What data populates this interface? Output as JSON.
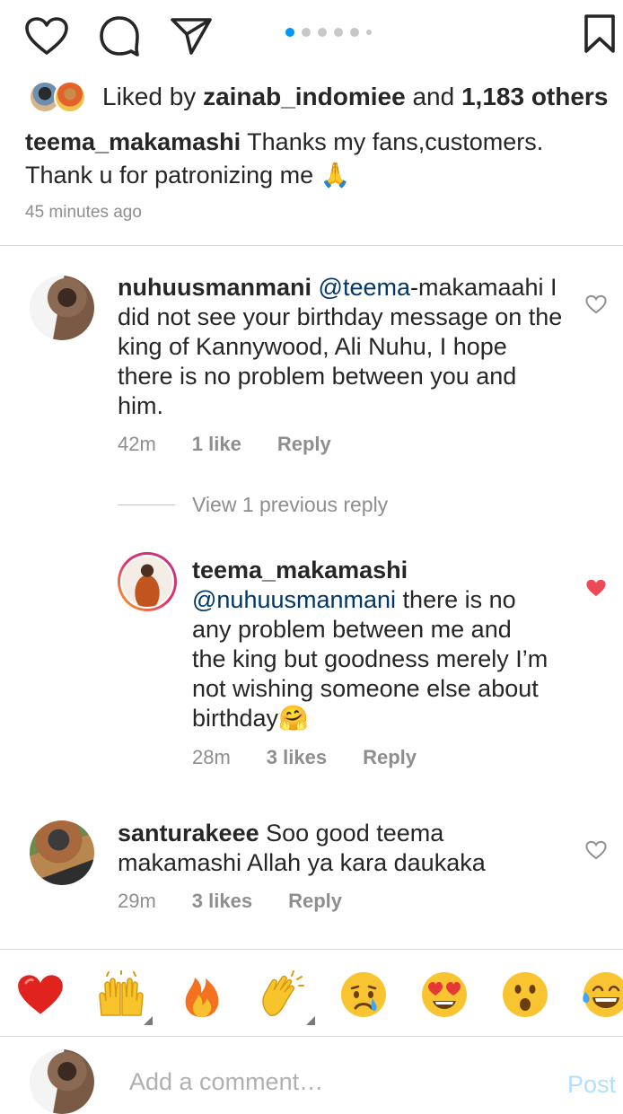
{
  "actions": {
    "like_icon": "heart-outline-icon",
    "comment_icon": "comment-bubble-icon",
    "share_icon": "send-paper-plane-icon",
    "save_icon": "bookmark-icon"
  },
  "carousel": {
    "total": 6,
    "active_index": 0
  },
  "likes": {
    "prefix": "Liked by ",
    "user": "zainab_indomiee",
    "middle": " and ",
    "others": "1,183 others"
  },
  "caption": {
    "username": "teema_makamashi",
    "text": " Thanks my fans,customers. Thank u for patronizing me 🙏"
  },
  "post_time": "45 minutes ago",
  "comments": [
    {
      "username": "nuhuusmanmani",
      "mention": "@teema",
      "text": "-makamaahi I did not see your birthday message on the king of Kannywood, Ali Nuhu, I hope there is no problem between you and him.",
      "time": "42m",
      "likes": "1 like",
      "reply_label": "Reply",
      "liked": false
    },
    {
      "username": "teema_makamashi",
      "mention": "@nuhuusmanmani",
      "text": " there is no any problem between me and the king but goodness merely I’m not wishing someone else about birthday🤗",
      "time": "28m",
      "likes": "3 likes",
      "reply_label": "Reply",
      "liked": true
    },
    {
      "username": "santurakeee",
      "mention": "",
      "text": " Soo good teema makamashi Allah ya kara daukaka",
      "time": "29m",
      "likes": "3 likes",
      "reply_label": "Reply",
      "liked": false
    }
  ],
  "view_replies": "View 1 previous reply",
  "emoji_bar": [
    "❤️",
    "🙌",
    "🔥",
    "👏",
    "😢",
    "😍",
    "😮",
    "😂"
  ],
  "add_comment": {
    "placeholder": "Add a comment…",
    "post_label": "Post"
  },
  "colors": {
    "link": "#00376b",
    "accent": "#0095f6",
    "liked_heart": "#ed4956",
    "muted": "#8e8e8e"
  }
}
